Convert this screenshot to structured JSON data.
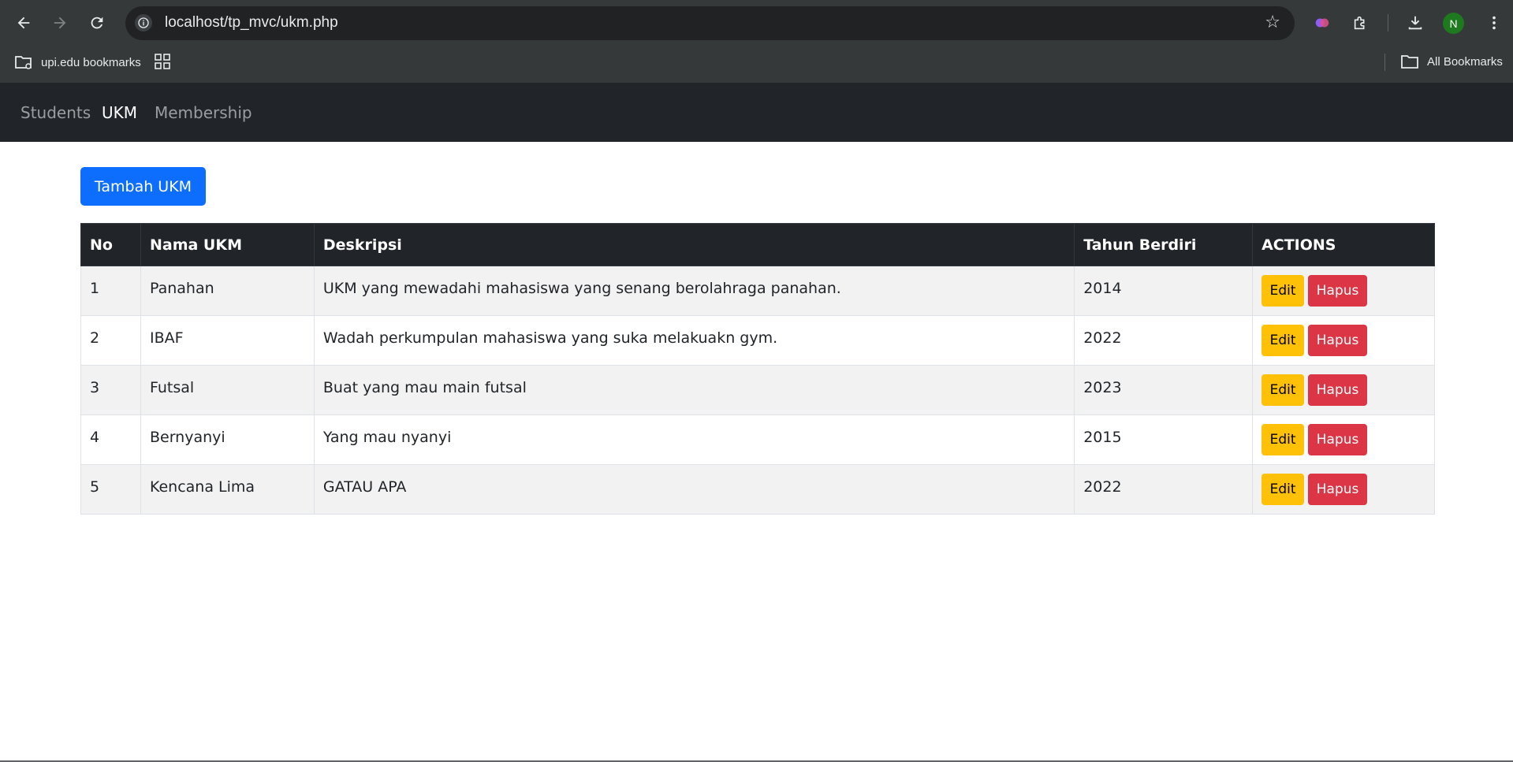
{
  "browser": {
    "url": "localhost/tp_mvc/ukm.php",
    "bookmarks": {
      "folder_label": "upi.edu bookmarks",
      "all_label": "All Bookmarks"
    },
    "profile_initial": "N"
  },
  "navbar": {
    "links": [
      {
        "label": "Students"
      },
      {
        "label": "UKM"
      },
      {
        "label": "Membership"
      }
    ],
    "active": "UKM"
  },
  "main": {
    "add_button_label": "Tambah UKM",
    "table": {
      "headers": [
        "No",
        "Nama UKM",
        "Deskripsi",
        "Tahun Berdiri",
        "ACTIONS"
      ],
      "rows": [
        {
          "no": "1",
          "nama": "Panahan",
          "deskripsi": "UKM yang mewadahi mahasiswa yang senang berolahraga panahan.",
          "tahun": "2014"
        },
        {
          "no": "2",
          "nama": "IBAF",
          "deskripsi": "Wadah perkumpulan mahasiswa yang suka melakuakn gym.",
          "tahun": "2022"
        },
        {
          "no": "3",
          "nama": "Futsal",
          "deskripsi": "Buat yang mau main futsal",
          "tahun": "2023"
        },
        {
          "no": "4",
          "nama": "Bernyanyi",
          "deskripsi": "Yang mau nyanyi",
          "tahun": "2015"
        },
        {
          "no": "5",
          "nama": "Kencana Lima",
          "deskripsi": "GATAU APA",
          "tahun": "2022"
        }
      ],
      "edit_label": "Edit",
      "delete_label": "Hapus"
    }
  },
  "colors": {
    "primary": "#0d6efd",
    "warning": "#ffc107",
    "danger": "#dc3545",
    "dark": "#212529"
  }
}
